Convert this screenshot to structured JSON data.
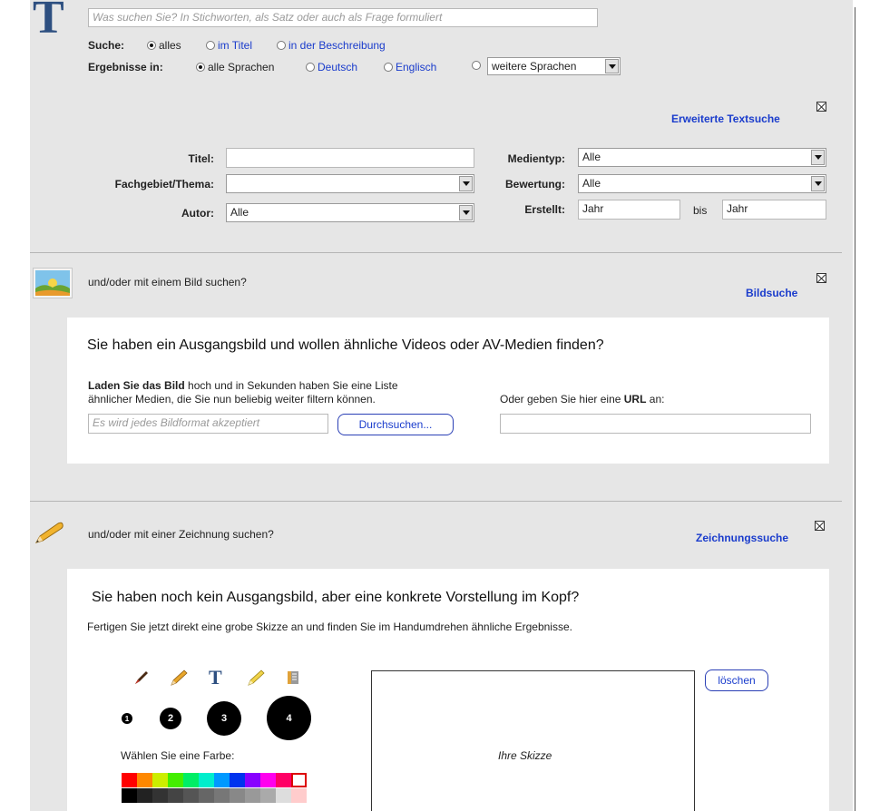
{
  "text_search": {
    "query_placeholder": "Was suchen Sie? In Stichworten, als Satz oder auch als Frage formuliert",
    "search_in_label": "Suche:",
    "search_in_options": [
      "alles",
      "im Titel",
      "in der Beschreibung"
    ],
    "results_in_label": "Ergebnisse in:",
    "language_options": [
      "alle Sprachen",
      "Deutsch",
      "Englisch"
    ],
    "more_languages_select": "weitere Sprachen",
    "advanced_link": "Erweiterte Textsuche"
  },
  "filters": {
    "title_label": "Titel:",
    "title_value": "",
    "subject_label": "Fachgebiet/Thema:",
    "subject_value": "",
    "author_label": "Autor:",
    "author_value": "Alle",
    "media_type_label": "Medientyp:",
    "media_type_value": "Alle",
    "rating_label": "Bewertung:",
    "rating_value": "Alle",
    "created_label": "Erstellt:",
    "created_from": "Jahr",
    "created_to_label": "bis",
    "created_to": "Jahr"
  },
  "image_search": {
    "prompt": "und/oder mit einem Bild suchen?",
    "link": "Bildsuche",
    "heading": "Sie haben ein Ausgangsbild und wollen ähnliche Videos oder AV-Medien finden?",
    "upload_bold": "Laden Sie das Bild",
    "upload_rest": " hoch und in Sekunden haben Sie eine Liste",
    "upload_line2": "ähnlicher Medien, die Sie nun beliebig weiter filtern können.",
    "file_placeholder": "Es wird jedes Bildformat akzeptiert",
    "browse_button": "Durchsuchen...",
    "url_label_pre": "Oder geben Sie hier eine ",
    "url_label_bold": "URL",
    "url_label_post": " an:",
    "url_value": ""
  },
  "sketch_search": {
    "prompt": "und/oder mit einer Zeichnung suchen?",
    "link": "Zeichnungssuche",
    "heading": "Sie haben noch kein Ausgangsbild, aber eine konkrete Vorstellung im Kopf?",
    "description": "Fertigen Sie jetzt direkt eine grobe Skizze an und finden Sie im Handumdrehen ähnliche Ergebnisse.",
    "tools": [
      "brush-icon",
      "pencil-icon",
      "text-tool-icon",
      "highlighter-icon",
      "eraser-icon"
    ],
    "text_tool_glyph": "T",
    "brush_sizes": [
      "1",
      "2",
      "3",
      "4"
    ],
    "color_label": "Wählen Sie eine Farbe:",
    "palette_row1": [
      "#ff0000",
      "#ff8800",
      "#ccee00",
      "#44ee00",
      "#00ee66",
      "#00eecc",
      "#0099ff",
      "#0033ee",
      "#8800ff",
      "#ff00ee",
      "#ff0066",
      "#ffffff"
    ],
    "palette_row2": [
      "#000000",
      "#222222",
      "#333333",
      "#444444",
      "#555555",
      "#666666",
      "#777777",
      "#888888",
      "#999999",
      "#aaaaaa",
      "#dddddd",
      "#ffcccc"
    ],
    "canvas_placeholder": "Ihre Skizze",
    "clear_button": "löschen"
  }
}
